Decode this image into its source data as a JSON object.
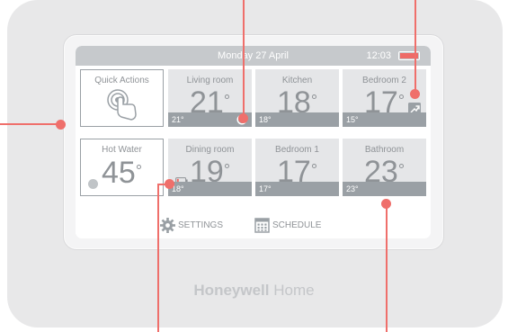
{
  "status_bar": {
    "date": "Monday 27 April",
    "time": "12:03"
  },
  "quick_actions": {
    "label": "Quick Actions"
  },
  "hot_water": {
    "label": "Hot Water",
    "temp": "45",
    "unit": "°"
  },
  "zones": [
    {
      "name": "Living room",
      "temp": "21",
      "unit": "°",
      "setpoint": "21°"
    },
    {
      "name": "Kitchen",
      "temp": "18",
      "unit": "°",
      "setpoint": "18°"
    },
    {
      "name": "Bedroom 2",
      "temp": "17",
      "unit": "°",
      "setpoint": "15°"
    },
    {
      "name": "Dining room",
      "temp": "19",
      "unit": "°",
      "setpoint": "18°"
    },
    {
      "name": "Bedroom 1",
      "temp": "17",
      "unit": "°",
      "setpoint": "17°"
    },
    {
      "name": "Bathroom",
      "temp": "23",
      "unit": "°",
      "setpoint": "23°"
    }
  ],
  "bottom": {
    "settings": "SETTINGS",
    "schedule": "SCHEDULE"
  },
  "brand": {
    "bold": "Honeywell",
    "light": "Home"
  },
  "colors": {
    "callout": "#ef6f6b",
    "tile_bg": "#e5e6e8",
    "setbar": "#9aa0a5",
    "battery": "#ee6b67"
  }
}
